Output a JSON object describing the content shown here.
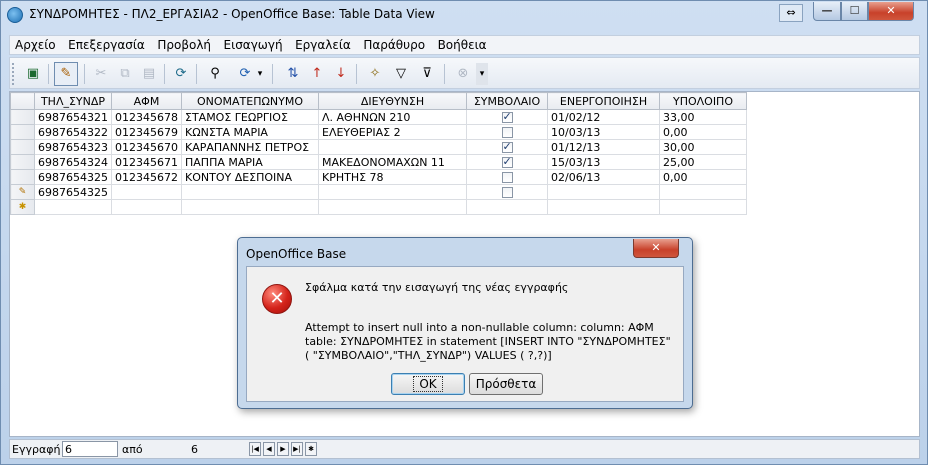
{
  "window": {
    "title": "ΣΥΝΔΡΟΜΗΤΕΣ - ΠΛ2_ΕΡΓΑΣΙΑ2 - OpenOffice Base: Table Data View",
    "restore_glyph": "⇔",
    "minimize_glyph": "—",
    "maximize_glyph": "☐",
    "close_glyph": "✕"
  },
  "menu": [
    "Αρχείο",
    "Επεξεργασία",
    "Προβολή",
    "Εισαγωγή",
    "Εργαλεία",
    "Παράθυρο",
    "Βοήθεια"
  ],
  "toolbar": {
    "save_icon": "▣",
    "edit_icon": "✎",
    "cut_icon": "✂",
    "copy_icon": "⧉",
    "paste_icon": "▤",
    "refresh_icon": "⟳",
    "find_icon": "⚲",
    "sort_icon": "⇅",
    "sort_asc_icon": "↑",
    "sort_desc_icon": "↓",
    "autofilter_icon": "✧",
    "filter_icon": "▽",
    "standard_filter_icon": "⊽",
    "remove_filter_icon": "⊗",
    "more_icon": "▾"
  },
  "grid": {
    "columns": [
      "ΤΗΛ_ΣΥΝΔΡ",
      "ΑΦΜ",
      "ΟΝΟΜΑΤΕΠΩΝΥΜΟ",
      "ΔΙΕΥΘΥΝΣΗ",
      "ΣΥΜΒΟΛΑΙΟ",
      "ΕΝΕΡΓΟΠΟΙΗΣΗ",
      "ΥΠΟΛΟΙΠΟ"
    ],
    "rows": [
      {
        "phone": "6987654321",
        "afm": "012345678",
        "name": "ΣΤΑΜΟΣ ΓΕΩΡΓΙΟΣ",
        "address": "Λ. ΑΘΗΝΩΝ 210",
        "contract": true,
        "activation": "01/02/12",
        "balance": "33,00"
      },
      {
        "phone": "6987654322",
        "afm": "012345679",
        "name": "ΚΩΝΣΤΑ ΜΑΡΙΑ",
        "address": "ΕΛΕΥΘΕΡΙΑΣ 2",
        "contract": false,
        "activation": "10/03/13",
        "balance": "0,00"
      },
      {
        "phone": "6987654323",
        "afm": "012345670",
        "name": "ΚΑΡΑΠΑΝΝΗΣ ΠΕΤΡΟΣ",
        "address": "",
        "contract": true,
        "activation": "01/12/13",
        "balance": "30,00"
      },
      {
        "phone": "6987654324",
        "afm": "012345671",
        "name": "ΠΑΠΠΑ ΜΑΡΙΑ",
        "address": "ΜΑΚΕΔΟΝΟΜΑΧΩΝ 11",
        "contract": true,
        "activation": "15/03/13",
        "balance": "25,00"
      },
      {
        "phone": "6987654325",
        "afm": "012345672",
        "name": "ΚΟΝΤΟΥ ΔΕΣΠΟΙΝΑ",
        "address": "ΚΡΗΤΗΣ 78",
        "contract": false,
        "activation": "02/06/13",
        "balance": "0,00"
      },
      {
        "phone": "6987654325",
        "afm": "",
        "name": "",
        "address": "",
        "contract": false,
        "activation": "",
        "balance": ""
      }
    ],
    "edit_row_icon": "✎",
    "new_row_icon": "✱"
  },
  "navbar": {
    "record_label": "Εγγραφή",
    "record_value": "6",
    "of_label": "από",
    "total_value": "6",
    "first_glyph": "|◀",
    "prev_glyph": "◀",
    "next_glyph": "▶",
    "last_glyph": "▶|"
  },
  "dialog": {
    "title": "OpenOffice Base",
    "close_glyph": "✕",
    "error_glyph": "✕",
    "message": "Σφάλμα κατά την εισαγωγή της νέας εγγραφής",
    "detail": "Attempt to insert null into a non-nullable column: column: ΑΦΜ\ntable: ΣΥΝΔΡΟΜΗΤΕΣ in statement [INSERT INTO \"ΣΥΝΔΡΟΜΗΤΕΣ\"\n( \"ΣΥΜΒΟΛΑΙΟ\",\"ΤΗΛ_ΣΥΝΔΡ\") VALUES ( ?,?)]",
    "ok_label": "OK",
    "more_label": "Πρόσθετα"
  }
}
